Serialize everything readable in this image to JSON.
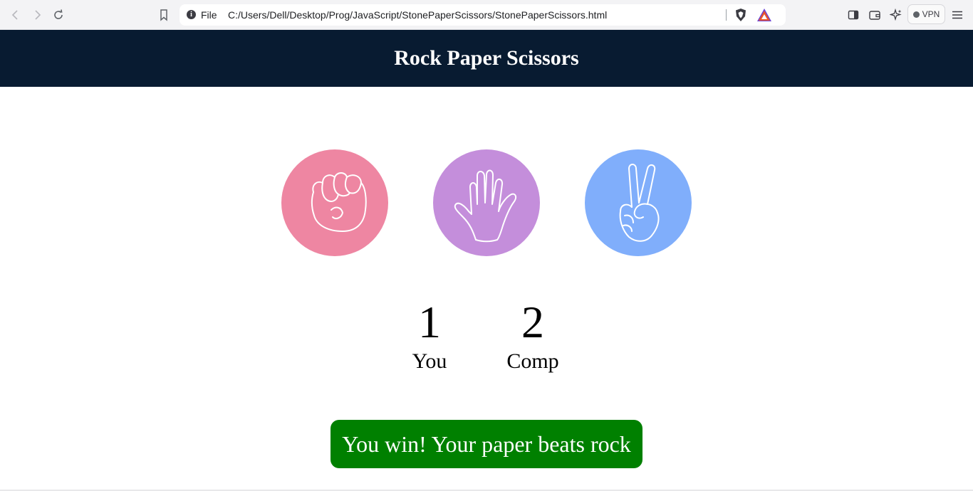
{
  "browser": {
    "scheme_label": "File",
    "url": "C:/Users/Dell/Desktop/Prog/JavaScript/StonePaperScissors/StonePaperScissors.html",
    "vpn_label": "VPN"
  },
  "header": {
    "title": "Rock Paper Scissors",
    "bg_color": "#081b31"
  },
  "choices": [
    {
      "id": "rock",
      "icon": "rock-hand-icon",
      "color": "#ee86a2"
    },
    {
      "id": "paper",
      "icon": "paper-hand-icon",
      "color": "#c48edb"
    },
    {
      "id": "scissors",
      "icon": "scissors-hand-icon",
      "color": "#80aefb"
    }
  ],
  "score": {
    "user": {
      "value": "1",
      "label": "You"
    },
    "comp": {
      "value": "2",
      "label": "Comp"
    }
  },
  "message": {
    "text": "You win! Your paper beats rock",
    "color": "#008000"
  }
}
